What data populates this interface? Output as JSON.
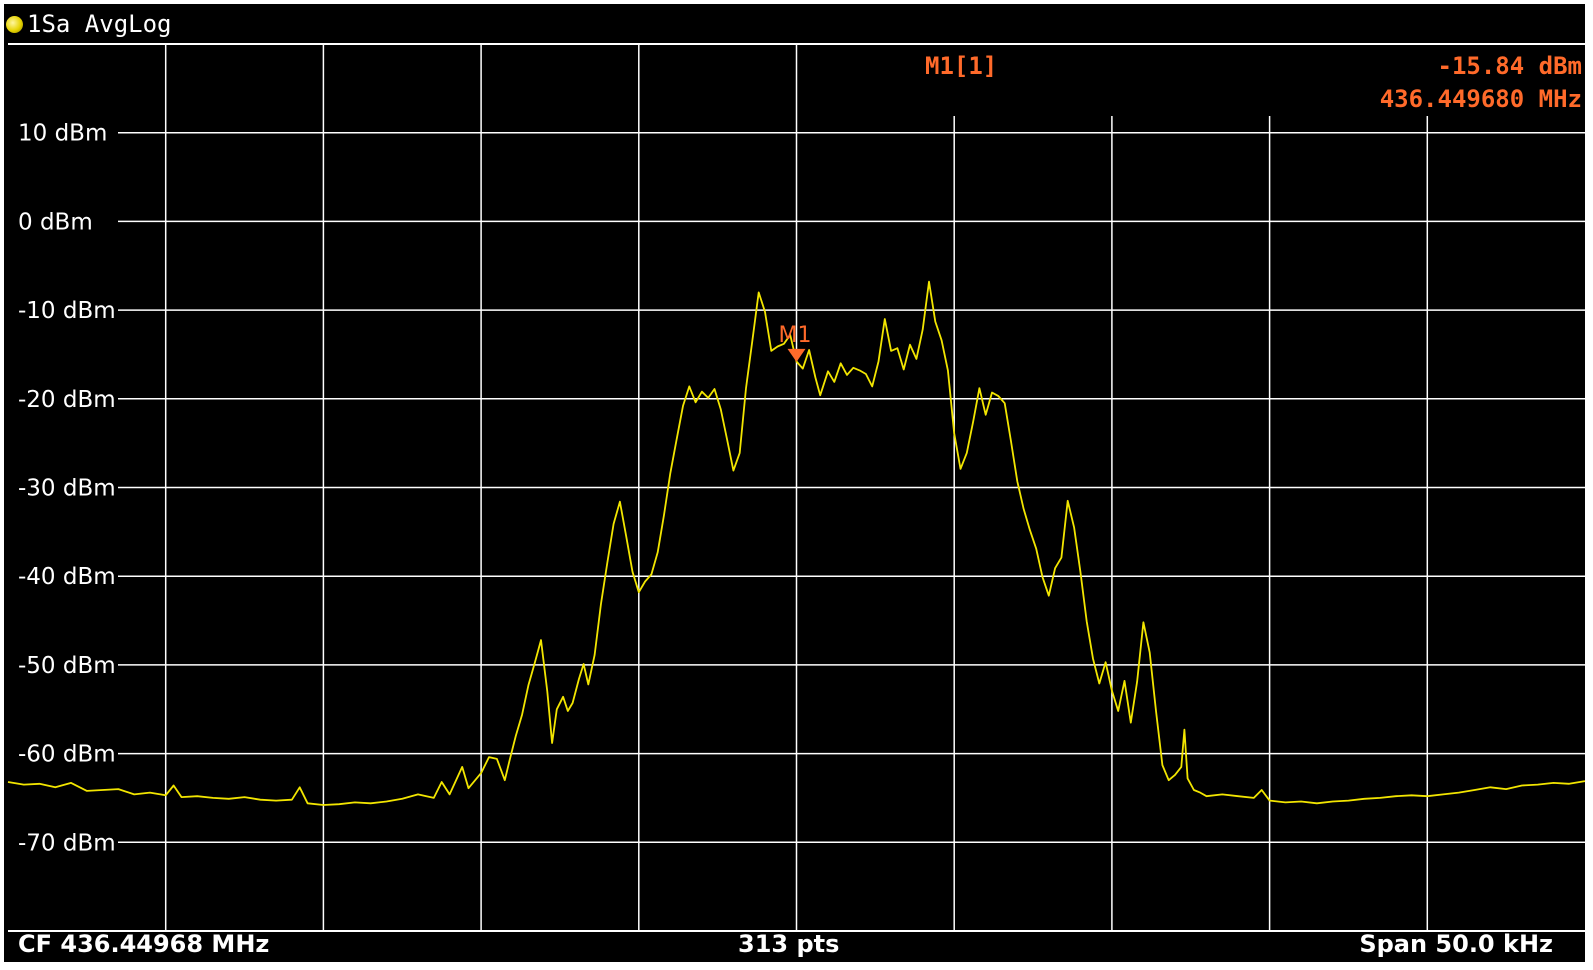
{
  "trace_label": "1Sa AvgLog",
  "marker": {
    "name": "M1[1]",
    "flag": "M1",
    "level": "-15.84 dBm",
    "frequency": "436.449680 MHz",
    "x_pos": 0.5,
    "y_value": -15.84
  },
  "footer": {
    "cf": "CF 436.44968 MHz",
    "pts": "313 pts",
    "span": "Span 50.0 kHz"
  },
  "colors": {
    "background": "#000000",
    "grid": "#ffffff",
    "trace": "#f2e500",
    "marker": "#ff6a2a"
  },
  "chart_data": {
    "type": "line",
    "title": "",
    "xlabel": "",
    "ylabel": "",
    "ylim": [
      -80,
      20
    ],
    "xlim": [
      0,
      1
    ],
    "yticks": [
      {
        "value": 10,
        "label": "10 dBm"
      },
      {
        "value": 0,
        "label": "0 dBm"
      },
      {
        "value": -10,
        "label": "-10 dBm"
      },
      {
        "value": -20,
        "label": "-20 dBm"
      },
      {
        "value": -30,
        "label": "-30 dBm"
      },
      {
        "value": -40,
        "label": "-40 dBm"
      },
      {
        "value": -50,
        "label": "-50 dBm"
      },
      {
        "value": -60,
        "label": "-60 dBm"
      },
      {
        "value": -70,
        "label": "-70 dBm"
      }
    ],
    "x_divisions": 10,
    "grid": true,
    "series": [
      {
        "values": [
          [
            0.0,
            -63.2
          ],
          [
            0.01,
            -63.5
          ],
          [
            0.02,
            -63.4
          ],
          [
            0.03,
            -63.8
          ],
          [
            0.04,
            -63.3
          ],
          [
            0.05,
            -64.2
          ],
          [
            0.06,
            -64.1
          ],
          [
            0.07,
            -64.0
          ],
          [
            0.08,
            -64.6
          ],
          [
            0.09,
            -64.4
          ],
          [
            0.1,
            -64.7
          ],
          [
            0.105,
            -63.6
          ],
          [
            0.11,
            -64.9
          ],
          [
            0.12,
            -64.8
          ],
          [
            0.13,
            -65.0
          ],
          [
            0.14,
            -65.1
          ],
          [
            0.15,
            -64.9
          ],
          [
            0.16,
            -65.2
          ],
          [
            0.17,
            -65.3
          ],
          [
            0.18,
            -65.2
          ],
          [
            0.185,
            -63.8
          ],
          [
            0.19,
            -65.6
          ],
          [
            0.2,
            -65.8
          ],
          [
            0.21,
            -65.7
          ],
          [
            0.22,
            -65.5
          ],
          [
            0.23,
            -65.6
          ],
          [
            0.24,
            -65.4
          ],
          [
            0.25,
            -65.1
          ],
          [
            0.26,
            -64.6
          ],
          [
            0.27,
            -65.0
          ],
          [
            0.275,
            -63.2
          ],
          [
            0.28,
            -64.6
          ],
          [
            0.288,
            -61.5
          ],
          [
            0.292,
            -63.9
          ],
          [
            0.3,
            -62.2
          ],
          [
            0.305,
            -60.4
          ],
          [
            0.31,
            -60.6
          ],
          [
            0.315,
            -63.0
          ],
          [
            0.318,
            -60.8
          ],
          [
            0.322,
            -58.0
          ],
          [
            0.326,
            -55.6
          ],
          [
            0.33,
            -52.3
          ],
          [
            0.334,
            -49.8
          ],
          [
            0.338,
            -47.2
          ],
          [
            0.342,
            -53.0
          ],
          [
            0.345,
            -58.8
          ],
          [
            0.348,
            -55.0
          ],
          [
            0.352,
            -53.6
          ],
          [
            0.355,
            -55.2
          ],
          [
            0.358,
            -54.3
          ],
          [
            0.362,
            -51.6
          ],
          [
            0.365,
            -49.9
          ],
          [
            0.368,
            -52.2
          ],
          [
            0.372,
            -48.9
          ],
          [
            0.376,
            -43.1
          ],
          [
            0.38,
            -38.5
          ],
          [
            0.384,
            -34.1
          ],
          [
            0.388,
            -31.6
          ],
          [
            0.392,
            -35.5
          ],
          [
            0.396,
            -39.5
          ],
          [
            0.4,
            -41.8
          ],
          [
            0.404,
            -40.6
          ],
          [
            0.408,
            -39.8
          ],
          [
            0.412,
            -37.3
          ],
          [
            0.416,
            -33.1
          ],
          [
            0.42,
            -28.4
          ],
          [
            0.424,
            -24.6
          ],
          [
            0.428,
            -20.8
          ],
          [
            0.432,
            -18.6
          ],
          [
            0.436,
            -20.4
          ],
          [
            0.44,
            -19.2
          ],
          [
            0.444,
            -19.9
          ],
          [
            0.448,
            -18.9
          ],
          [
            0.452,
            -21.2
          ],
          [
            0.456,
            -24.6
          ],
          [
            0.46,
            -28.1
          ],
          [
            0.464,
            -26.1
          ],
          [
            0.468,
            -18.8
          ],
          [
            0.472,
            -13.5
          ],
          [
            0.476,
            -8.0
          ],
          [
            0.48,
            -10.2
          ],
          [
            0.484,
            -14.6
          ],
          [
            0.488,
            -14.1
          ],
          [
            0.492,
            -13.8
          ],
          [
            0.496,
            -12.8
          ],
          [
            0.5,
            -15.8
          ],
          [
            0.504,
            -16.6
          ],
          [
            0.508,
            -14.5
          ],
          [
            0.512,
            -17.6
          ],
          [
            0.515,
            -19.6
          ],
          [
            0.52,
            -16.9
          ],
          [
            0.524,
            -18.1
          ],
          [
            0.528,
            -16.0
          ],
          [
            0.532,
            -17.3
          ],
          [
            0.536,
            -16.5
          ],
          [
            0.54,
            -16.8
          ],
          [
            0.544,
            -17.2
          ],
          [
            0.548,
            -18.6
          ],
          [
            0.552,
            -15.8
          ],
          [
            0.556,
            -11.0
          ],
          [
            0.56,
            -14.6
          ],
          [
            0.564,
            -14.3
          ],
          [
            0.568,
            -16.7
          ],
          [
            0.572,
            -13.9
          ],
          [
            0.576,
            -15.5
          ],
          [
            0.58,
            -12.2
          ],
          [
            0.584,
            -6.8
          ],
          [
            0.588,
            -11.3
          ],
          [
            0.592,
            -13.4
          ],
          [
            0.596,
            -16.8
          ],
          [
            0.6,
            -23.9
          ],
          [
            0.604,
            -27.9
          ],
          [
            0.608,
            -26.1
          ],
          [
            0.612,
            -22.6
          ],
          [
            0.616,
            -18.8
          ],
          [
            0.62,
            -21.8
          ],
          [
            0.624,
            -19.3
          ],
          [
            0.628,
            -19.7
          ],
          [
            0.632,
            -20.5
          ],
          [
            0.636,
            -24.8
          ],
          [
            0.64,
            -29.3
          ],
          [
            0.644,
            -32.4
          ],
          [
            0.648,
            -34.8
          ],
          [
            0.652,
            -36.9
          ],
          [
            0.656,
            -40.1
          ],
          [
            0.66,
            -42.2
          ],
          [
            0.664,
            -39.1
          ],
          [
            0.668,
            -37.9
          ],
          [
            0.672,
            -31.5
          ],
          [
            0.676,
            -34.5
          ],
          [
            0.68,
            -39.5
          ],
          [
            0.684,
            -45.1
          ],
          [
            0.688,
            -49.3
          ],
          [
            0.692,
            -52.1
          ],
          [
            0.696,
            -49.7
          ],
          [
            0.7,
            -52.9
          ],
          [
            0.704,
            -55.2
          ],
          [
            0.708,
            -51.8
          ],
          [
            0.712,
            -56.5
          ],
          [
            0.716,
            -51.9
          ],
          [
            0.72,
            -45.2
          ],
          [
            0.724,
            -48.6
          ],
          [
            0.728,
            -55.3
          ],
          [
            0.732,
            -61.3
          ],
          [
            0.736,
            -63.0
          ],
          [
            0.74,
            -62.4
          ],
          [
            0.744,
            -61.5
          ],
          [
            0.746,
            -57.3
          ],
          [
            0.748,
            -62.8
          ],
          [
            0.752,
            -64.1
          ],
          [
            0.756,
            -64.4
          ],
          [
            0.76,
            -64.8
          ],
          [
            0.77,
            -64.6
          ],
          [
            0.78,
            -64.8
          ],
          [
            0.79,
            -65.0
          ],
          [
            0.795,
            -64.1
          ],
          [
            0.8,
            -65.3
          ],
          [
            0.81,
            -65.5
          ],
          [
            0.82,
            -65.4
          ],
          [
            0.83,
            -65.6
          ],
          [
            0.84,
            -65.4
          ],
          [
            0.85,
            -65.3
          ],
          [
            0.86,
            -65.1
          ],
          [
            0.87,
            -65.0
          ],
          [
            0.88,
            -64.8
          ],
          [
            0.89,
            -64.7
          ],
          [
            0.9,
            -64.8
          ],
          [
            0.91,
            -64.6
          ],
          [
            0.92,
            -64.4
          ],
          [
            0.93,
            -64.1
          ],
          [
            0.94,
            -63.8
          ],
          [
            0.95,
            -64.0
          ],
          [
            0.96,
            -63.6
          ],
          [
            0.97,
            -63.5
          ],
          [
            0.98,
            -63.3
          ],
          [
            0.99,
            -63.4
          ],
          [
            1.0,
            -63.1
          ]
        ]
      }
    ]
  }
}
